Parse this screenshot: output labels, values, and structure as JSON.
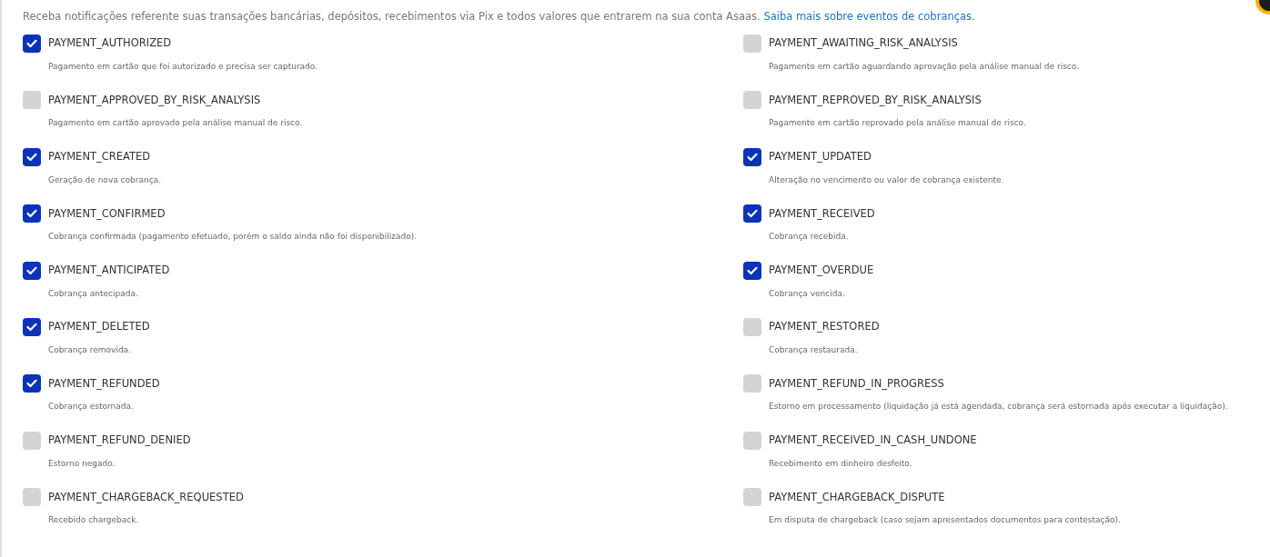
{
  "intro": {
    "text": "Receba notificações referente suas transações bancárias, depósitos, recebimentos via Pix e todos valores que entrarem na sua conta Asaas.",
    "link": "Saiba mais sobre eventos de cobranças."
  },
  "events": [
    {
      "name": "PAYMENT_AUTHORIZED",
      "description": "Pagamento em cartão que foi autorizado e precisa ser capturado.",
      "checked": true
    },
    {
      "name": "PAYMENT_AWAITING_RISK_ANALYSIS",
      "description": "Pagamento em cartão aguardando aprovação pela análise manual de risco.",
      "checked": false
    },
    {
      "name": "PAYMENT_APPROVED_BY_RISK_ANALYSIS",
      "description": "Pagamento em cartão aprovado pela análise manual de risco.",
      "checked": false
    },
    {
      "name": "PAYMENT_REPROVED_BY_RISK_ANALYSIS",
      "description": "Pagamento em cartão reprovado pela análise manual de risco.",
      "checked": false
    },
    {
      "name": "PAYMENT_CREATED",
      "description": "Geração de nova cobrança.",
      "checked": true
    },
    {
      "name": "PAYMENT_UPDATED",
      "description": "Alteração no vencimento ou valor de cobrança existente.",
      "checked": true
    },
    {
      "name": "PAYMENT_CONFIRMED",
      "description": "Cobrança confirmada (pagamento efetuado, porém o saldo ainda não foi disponibilizado).",
      "checked": true
    },
    {
      "name": "PAYMENT_RECEIVED",
      "description": "Cobrança recebida.",
      "checked": true
    },
    {
      "name": "PAYMENT_ANTICIPATED",
      "description": "Cobrança antecipada.",
      "checked": true
    },
    {
      "name": "PAYMENT_OVERDUE",
      "description": "Cobrança vencida.",
      "checked": true
    },
    {
      "name": "PAYMENT_DELETED",
      "description": "Cobrança removida.",
      "checked": true
    },
    {
      "name": "PAYMENT_RESTORED",
      "description": "Cobrança restaurada.",
      "checked": false
    },
    {
      "name": "PAYMENT_REFUNDED",
      "description": "Cobrança estornada.",
      "checked": true
    },
    {
      "name": "PAYMENT_REFUND_IN_PROGRESS",
      "description": "Estorno em processamento (liquidação já está agendada, cobrança será estornada após executar a liquidação).",
      "checked": false
    },
    {
      "name": "PAYMENT_REFUND_DENIED",
      "description": "Estorno negado.",
      "checked": false
    },
    {
      "name": "PAYMENT_RECEIVED_IN_CASH_UNDONE",
      "description": "Recebimento em dinheiro desfeito.",
      "checked": false
    },
    {
      "name": "PAYMENT_CHARGEBACK_REQUESTED",
      "description": "Recebido chargeback.",
      "checked": false
    },
    {
      "name": "PAYMENT_CHARGEBACK_DISPUTE",
      "description": "Em disputa de chargeback (caso sejam apresentados documentos para contestação).",
      "checked": false
    }
  ]
}
